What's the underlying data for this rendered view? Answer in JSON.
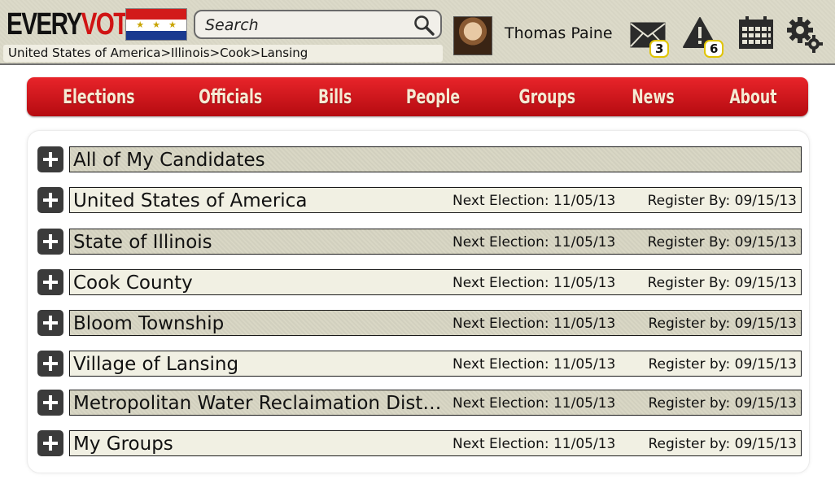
{
  "header": {
    "logo": {
      "every": "EVERY",
      "vote": "VOTE"
    },
    "search": {
      "placeholder": "Search",
      "icon": "search-icon"
    },
    "breadcrumb": "United States of America>Illinois>Cook>Lansing",
    "user": {
      "name": "Thomas Paine"
    },
    "messages": {
      "icon": "mail-icon",
      "count": "3"
    },
    "alerts": {
      "icon": "alert-icon",
      "count": "6"
    },
    "calendar": {
      "icon": "calendar-icon"
    },
    "settings": {
      "icon": "gear-icon"
    }
  },
  "nav": {
    "items": [
      {
        "label": "Elections"
      },
      {
        "label": "Officials"
      },
      {
        "label": "Bills"
      },
      {
        "label": "People"
      },
      {
        "label": "Groups"
      },
      {
        "label": "News"
      },
      {
        "label": "About"
      }
    ]
  },
  "list": {
    "rows": [
      {
        "title": "All of My Candidates",
        "next": "",
        "register": ""
      },
      {
        "title": "United States of America",
        "next": "Next Election: 11/05/13",
        "register": "Register By: 09/15/13"
      },
      {
        "title": "State of Illinois",
        "next": "Next Election: 11/05/13",
        "register": "Register By: 09/15/13"
      },
      {
        "title": "Cook County",
        "next": "Next Election: 11/05/13",
        "register": "Register By: 09/15/13"
      },
      {
        "title": "Bloom Township",
        "next": "Next Election: 11/05/13",
        "register": "Register by: 09/15/13"
      },
      {
        "title": "Village of Lansing",
        "next": "Next Election: 11/05/13",
        "register": "Register by: 09/15/13"
      },
      {
        "title": "Metropolitan Water Reclaimation District",
        "next": "Next Election: 11/05/13",
        "register": "Register by: 09/15/13"
      },
      {
        "title": "My Groups",
        "next": "Next Election: 11/05/13",
        "register": "Register by: 09/15/13"
      }
    ]
  },
  "colors": {
    "brand_red": "#d01414",
    "nav_red": "#c8141a",
    "badge_border": "#e0c400",
    "header_bg": "#dcdac9"
  }
}
